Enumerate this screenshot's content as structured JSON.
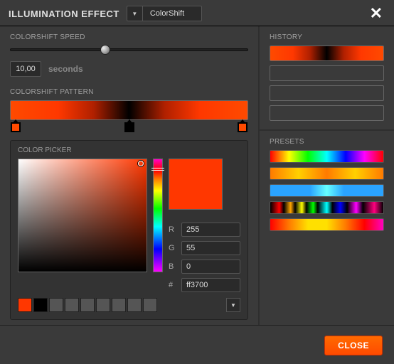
{
  "header": {
    "title": "ILLUMINATION EFFECT",
    "dropdown_value": "ColorShift"
  },
  "speed": {
    "label": "COLORSHIFT SPEED",
    "value": "10,00",
    "unit": "seconds",
    "slider_pos_pct": 40
  },
  "pattern": {
    "label": "COLORSHIFT PATTERN",
    "stops": [
      {
        "pos_pct": 2,
        "color": "#ff4a00"
      },
      {
        "pos_pct": 50,
        "color": "#000000"
      },
      {
        "pos_pct": 98,
        "color": "#ff4a00"
      }
    ]
  },
  "picker": {
    "label": "COLOR PICKER",
    "preview": "#ff3700",
    "r_label": "R",
    "r": "255",
    "g_label": "G",
    "g": "55",
    "b_label": "B",
    "b": "0",
    "hex_label": "#",
    "hex": "ff3700",
    "swatches": [
      "#ff3700",
      "#000000",
      "#555555",
      "#555555",
      "#555555",
      "#555555",
      "#555555",
      "#555555",
      "#555555"
    ]
  },
  "history": {
    "label": "HISTORY",
    "slots": [
      {
        "filled": true
      },
      {
        "filled": false
      },
      {
        "filled": false
      },
      {
        "filled": false
      }
    ]
  },
  "presets": {
    "label": "PRESETS",
    "items": [
      "rainbow",
      "amber",
      "blue",
      "rainbow-pulse",
      "fire"
    ]
  },
  "footer": {
    "close": "CLOSE"
  },
  "colors": {
    "accent": "#ff4a00"
  }
}
